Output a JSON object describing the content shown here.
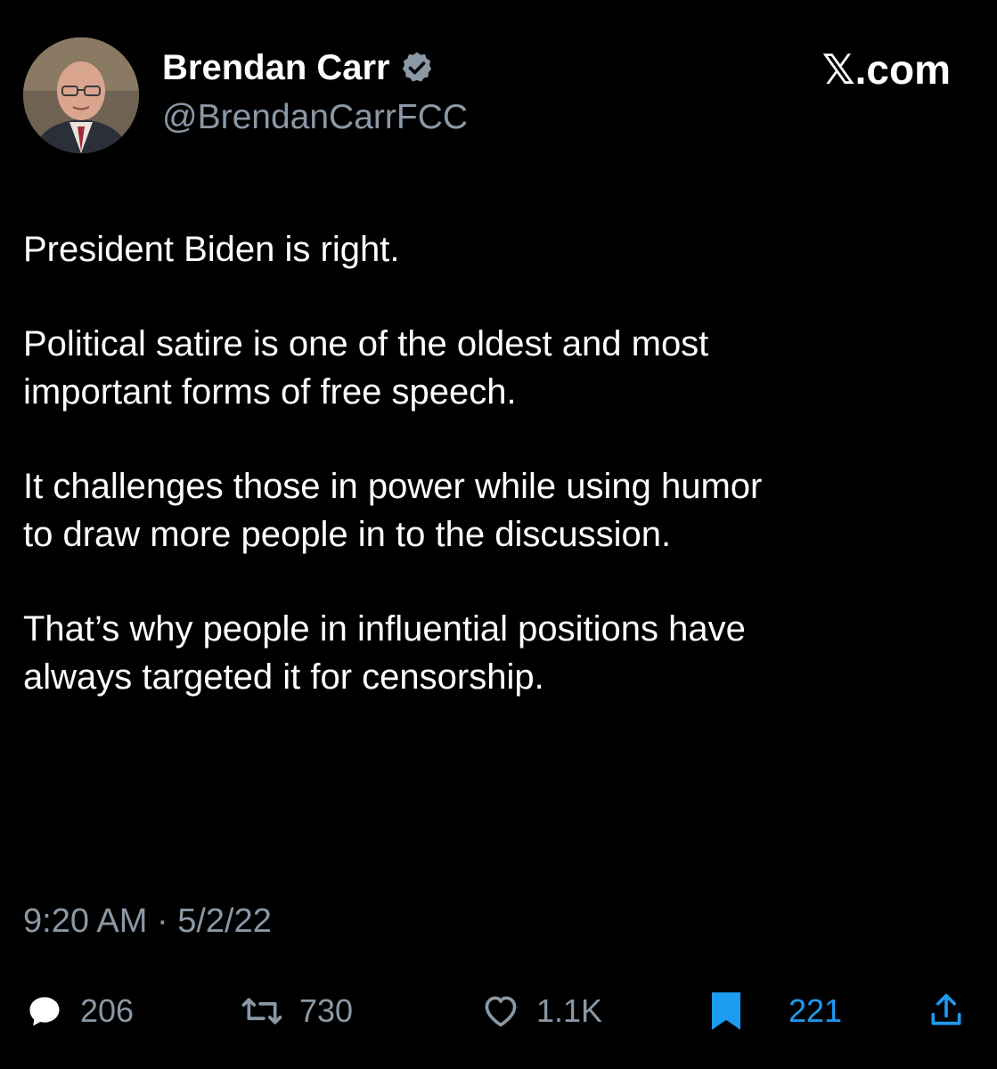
{
  "author": {
    "display_name": "Brendan Carr",
    "handle": "@BrendanCarrFCC",
    "verified": true,
    "verified_badge_color": "#8b98a5",
    "avatar_icon": "profile-photo"
  },
  "watermark": "𝕏.com",
  "tweet": {
    "paragraphs": [
      "President Biden is right.",
      "Political satire is one of the oldest and most\nimportant forms of free speech.",
      "It challenges those in power while using humor\nto draw more people in to the discussion.",
      "That’s why people in influential positions have\nalways targeted it for censorship."
    ],
    "timestamp": "9:20 AM · 5/2/22"
  },
  "actions": {
    "reply": {
      "icon": "reply-icon",
      "count": "206"
    },
    "retweet": {
      "icon": "retweet-icon",
      "count": "730"
    },
    "like": {
      "icon": "heart-icon",
      "count": "1.1K"
    },
    "bookmark": {
      "icon": "bookmark-icon",
      "count": "221",
      "color": "#1d9bf0"
    },
    "share": {
      "icon": "share-icon"
    }
  },
  "colors": {
    "background": "#000000",
    "text": "#ffffff",
    "secondary": "#8b98a5",
    "accent": "#1d9bf0"
  }
}
